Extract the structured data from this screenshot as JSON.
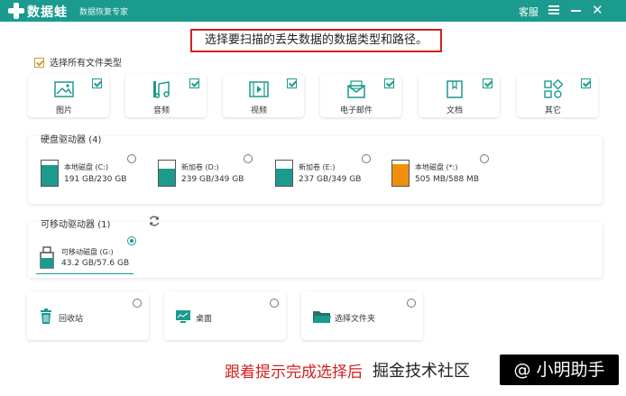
{
  "titlebar": {
    "app_title": "数据蛙",
    "app_subtitle": "数据恢复专家",
    "service": "客服",
    "close": "✕",
    "color": "#1a9b8e"
  },
  "instruction": "选择要扫描的丢失数据的数据类型和路径。",
  "select_all": {
    "label": "选择所有文件类型",
    "checked": true
  },
  "file_types": [
    {
      "label": "图片",
      "icon": "image-icon",
      "checked": true
    },
    {
      "label": "音频",
      "icon": "music-icon",
      "checked": true
    },
    {
      "label": "视频",
      "icon": "video-icon",
      "checked": true
    },
    {
      "label": "电子邮件",
      "icon": "email-icon",
      "checked": true
    },
    {
      "label": "文档",
      "icon": "document-icon",
      "checked": true
    },
    {
      "label": "其它",
      "icon": "other-icon",
      "checked": true
    }
  ],
  "hard_drives": {
    "title": "硬盘驱动器",
    "count": "(4)",
    "items": [
      {
        "name": "本地磁盘 (C:)",
        "size": "191 GB/230 GB",
        "used_fraction": 0.83,
        "fill": "#1a9b8e",
        "selected": false
      },
      {
        "name": "新加卷 (D:)",
        "size": "239 GB/349 GB",
        "used_fraction": 0.68,
        "fill": "#1a9b8e",
        "selected": false
      },
      {
        "name": "新加卷 (E:)",
        "size": "237 GB/349 GB",
        "used_fraction": 0.68,
        "fill": "#1a9b8e",
        "selected": false
      },
      {
        "name": "本地磁盘 (*:)",
        "size": "505 MB/588 MB",
        "used_fraction": 0.86,
        "fill": "#f0900a",
        "selected": false
      }
    ]
  },
  "removable": {
    "title": "可移动驱动器",
    "count": "(1)",
    "items": [
      {
        "name": "可移动磁盘 (G:)",
        "size": "43.2 GB/57.6 GB",
        "used_fraction": 0.75,
        "selected": true
      }
    ]
  },
  "locations": [
    {
      "label": "回收站",
      "icon": "recycle-bin-icon"
    },
    {
      "label": "桌面",
      "icon": "desktop-icon"
    },
    {
      "label": "选择文件夹",
      "icon": "folder-icon"
    }
  ],
  "watermark": {
    "red_text": "跟着提示完成选择后",
    "gray_text": "掘金技术社区",
    "box_text": "@ 小明助手"
  }
}
